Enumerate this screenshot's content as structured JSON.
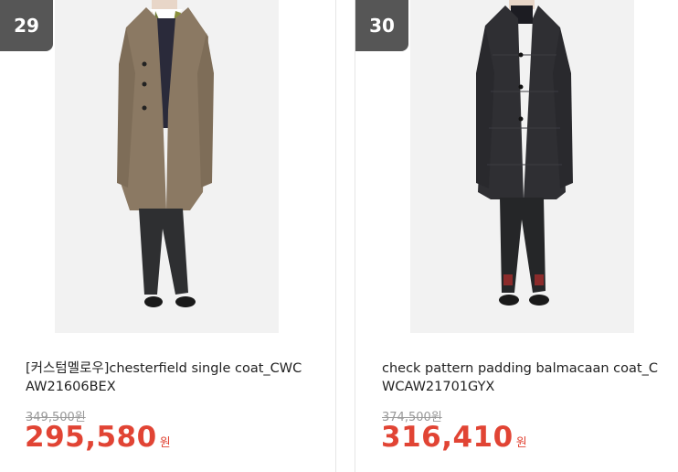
{
  "products": [
    {
      "rank": "29",
      "title": "[커스텀멜로우]chesterfield single coat_CWCAW21606BEX",
      "original_price": "349,500원",
      "sale_price": "295,580",
      "currency": "원",
      "image_icon": "coat-beige-photo-icon"
    },
    {
      "rank": "30",
      "title": "check pattern padding balmacaan coat_CWCAW21701GYX",
      "original_price": "374,500원",
      "sale_price": "316,410",
      "currency": "원",
      "image_icon": "coat-charcoal-photo-icon"
    }
  ],
  "colors": {
    "rank_badge": "#565656",
    "sale_price": "#e14434",
    "original_price": "#999999"
  }
}
